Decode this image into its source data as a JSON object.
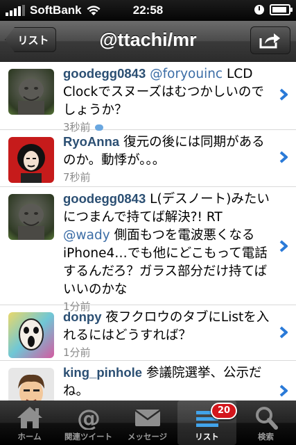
{
  "status_bar": {
    "carrier": "SoftBank",
    "time": "22:58"
  },
  "nav": {
    "back_label": "リスト",
    "title": "@ttachi/mr"
  },
  "tweets": [
    {
      "user": "goodegg0843",
      "mention": "@foryouinc",
      "text": "LCD Clockでスヌーズはむつかしいのでしょうか？",
      "time": "3秒前",
      "has_reply_icon": true
    },
    {
      "user": "RyoAnna",
      "text": "復元の後には同期があるのか。動悸が。。。",
      "time": "7秒前"
    },
    {
      "user": "goodegg0843",
      "text_before": "L(デスノート)みたいにつまんで持てば解決?! RT",
      "mention": "@wady",
      "text_after": "側面もつを電波悪くなるiPhone4…でも他にどこもって電話するんだろ？ガラス部分だけ持てばいいのかな",
      "time": "1分前"
    },
    {
      "user": "donpy",
      "text": "夜フクロウのタブにListを入れるにはどうすれば？",
      "time": "1分前"
    },
    {
      "user": "king_pinhole",
      "text": "参議院選挙、公示だね。",
      "time": ""
    }
  ],
  "tabs": [
    {
      "label": "ホーム",
      "icon": "home-icon"
    },
    {
      "label": "関連ツイート",
      "icon": "at-icon"
    },
    {
      "label": "メッセージ",
      "icon": "envelope-icon"
    },
    {
      "label": "リスト",
      "icon": "list-icon",
      "badge": "20",
      "active": true
    },
    {
      "label": "検索",
      "icon": "search-icon"
    }
  ],
  "colors": {
    "username": "#2b4f73",
    "mention": "#3b6da6",
    "chevron": "#2a7ad8",
    "badge": "#d3161c"
  }
}
